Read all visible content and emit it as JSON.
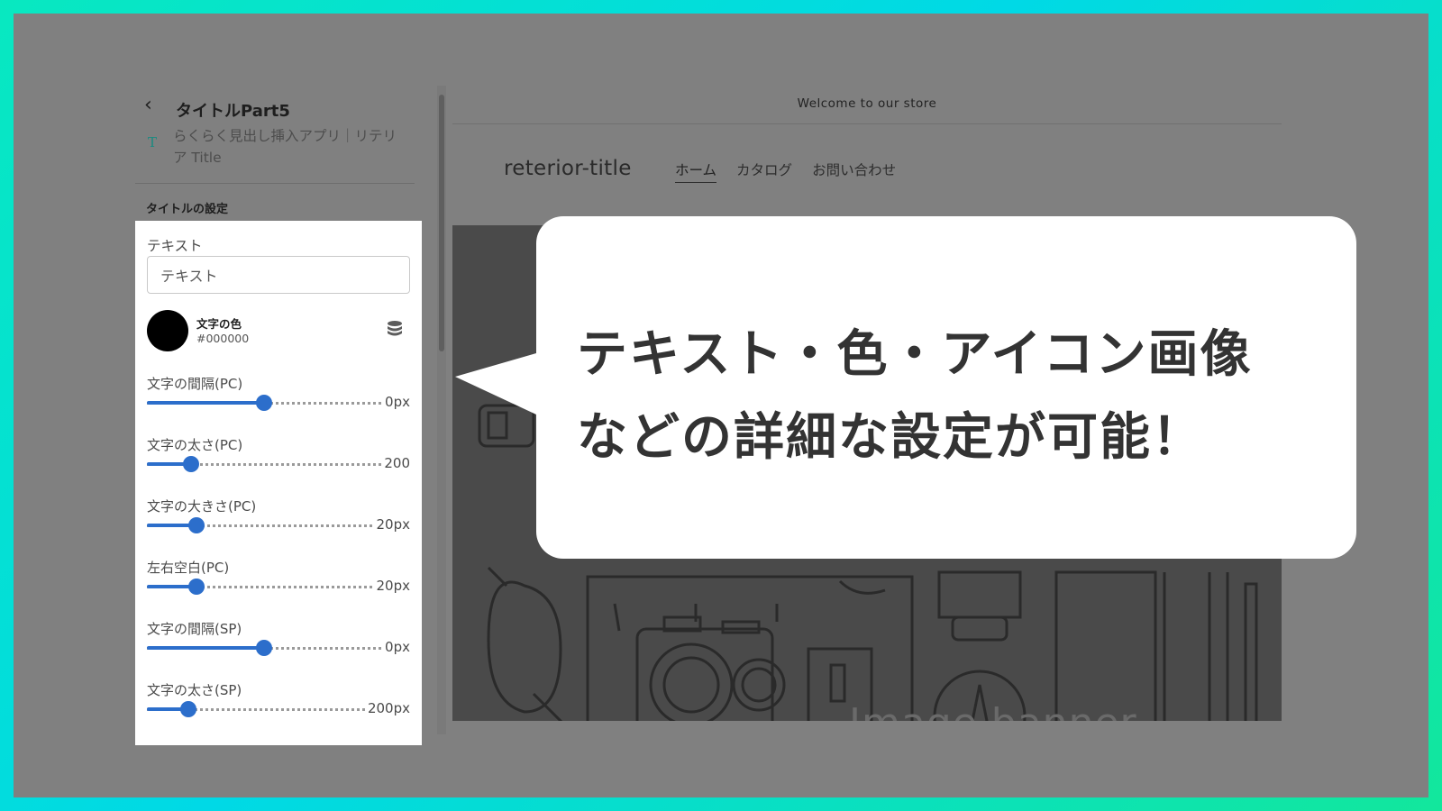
{
  "editor": {
    "title": "タイトルPart5",
    "app_name": "らくらく見出し挿入アプリ｜リテリア Title",
    "section_title": "タイトルの設定",
    "text_field": {
      "label": "テキスト",
      "value": "テキスト"
    },
    "color": {
      "label": "文字の色",
      "hex": "#000000"
    },
    "sliders": [
      {
        "label": "文字の間隔(PC)",
        "value": "0px",
        "fill": 0.5
      },
      {
        "label": "文字の太さ(PC)",
        "value": "200",
        "fill": 0.19
      },
      {
        "label": "文字の大きさ(PC)",
        "value": "20px",
        "fill": 0.22
      },
      {
        "label": "左右空白(PC)",
        "value": "20px",
        "fill": 0.22
      },
      {
        "label": "文字の間隔(SP)",
        "value": "0px",
        "fill": 0.5
      },
      {
        "label": "文字の太さ(SP)",
        "value": "200px",
        "fill": 0.19
      }
    ]
  },
  "preview": {
    "announcement": "Welcome to our store",
    "store_title": "reterior-title",
    "nav": [
      "ホーム",
      "カタログ",
      "お問い合わせ"
    ],
    "banner_title": "Image banner"
  },
  "callout": {
    "line1": "テキスト・色・アイコン画像",
    "line2": "などの詳細な設定が可能！"
  },
  "colors": {
    "accent": "#2c6ecb",
    "frame_gradient": "#08e8c0"
  }
}
